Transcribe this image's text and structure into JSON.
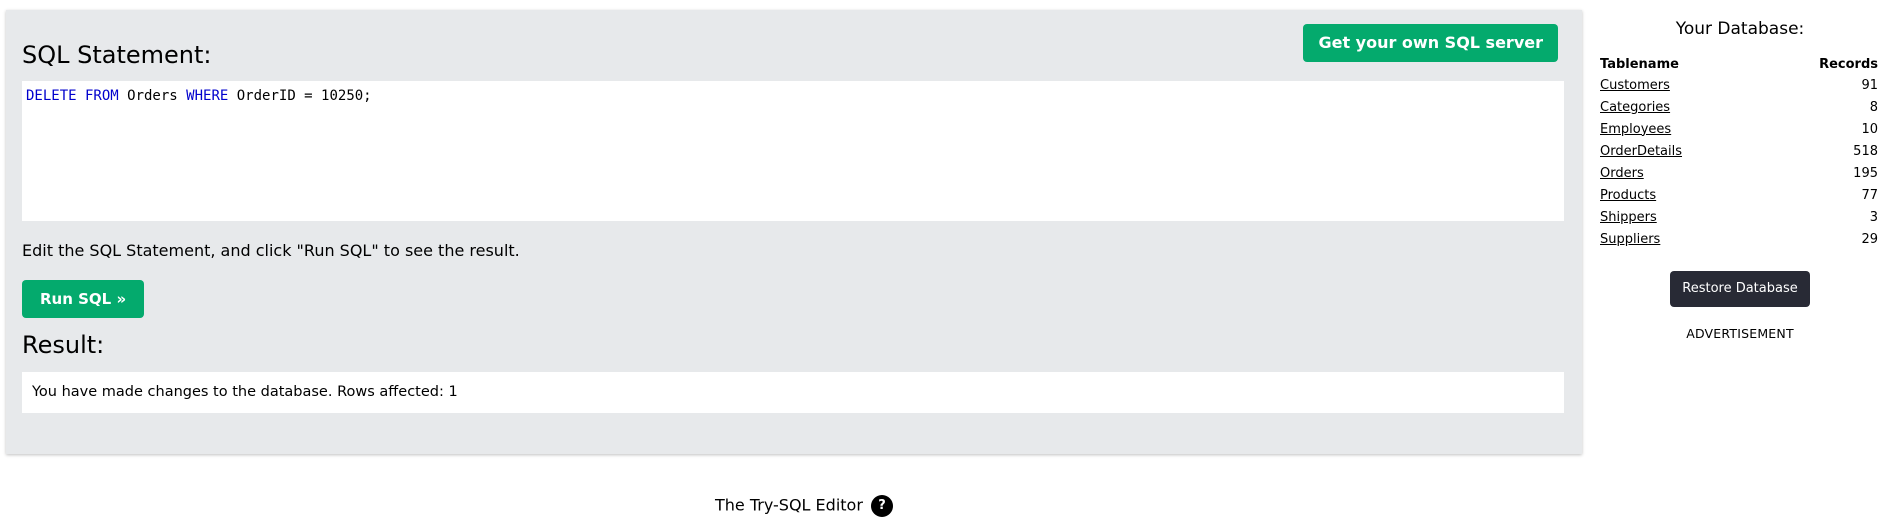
{
  "editor": {
    "heading": "SQL Statement:",
    "get_server_label": "Get your own SQL server",
    "code": {
      "kw1": "DELETE FROM",
      "table": " Orders ",
      "kw2": "WHERE",
      "rest": " OrderID = 10250;"
    },
    "instruction": "Edit the SQL Statement, and click \"Run SQL\" to see the result.",
    "run_label": "Run SQL »"
  },
  "result": {
    "heading": "Result:",
    "message": "You have made changes to the database. Rows affected: 1"
  },
  "sidebar": {
    "title": "Your Database:",
    "col_tablename": "Tablename",
    "col_records": "Records",
    "tables": [
      {
        "name": "Customers",
        "records": "91"
      },
      {
        "name": "Categories",
        "records": "8"
      },
      {
        "name": "Employees",
        "records": "10"
      },
      {
        "name": "OrderDetails",
        "records": "518"
      },
      {
        "name": "Orders",
        "records": "195"
      },
      {
        "name": "Products",
        "records": "77"
      },
      {
        "name": "Shippers",
        "records": "3"
      },
      {
        "name": "Suppliers",
        "records": "29"
      }
    ],
    "restore_label": "Restore Database",
    "advertisement": "ADVERTISEMENT"
  },
  "footer": {
    "text": "The Try-SQL Editor",
    "help_icon": "?"
  },
  "colors": {
    "accent_green": "#04aa6d",
    "dark_button": "#282a35",
    "panel_bg": "#e7e9eb",
    "keyword_blue": "#0000cd"
  }
}
